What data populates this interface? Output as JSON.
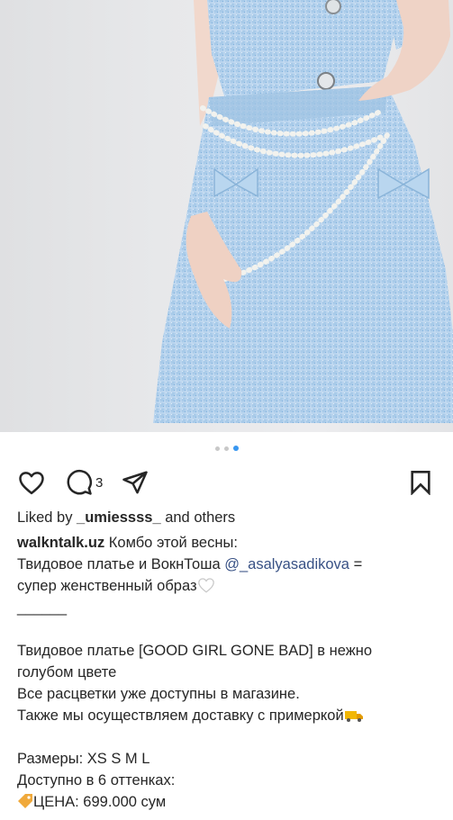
{
  "post": {
    "image_description_icon": "photo",
    "carousel": {
      "count": 3,
      "active_index": 2
    },
    "actions": {
      "like_icon": "heart-icon",
      "comment_icon": "comment-icon",
      "comment_count": "3",
      "share_icon": "send-icon",
      "save_icon": "bookmark-icon"
    },
    "likes": {
      "prefix": "Liked by ",
      "user": "_umiessss_",
      "suffix": " and others"
    },
    "caption": {
      "username": "walkntalk.uz",
      "line1": " Комбо этой весны:",
      "line2_before": "Твидовое платье и ВокнТоша ",
      "mention": "@_asalyasadikova",
      "line2_after": " =",
      "line3": "супер женственный образ",
      "line3_emoji": "white-heart",
      "divider": "______",
      "line4": "Твидовое платье [GOOD GIRL GONE BAD] в нежно",
      "line5": "голубом цвете",
      "line6": "Все расцветки уже доступны в магазине.",
      "line7": "Также мы осуществляем доставку с примеркой",
      "line7_emoji": "delivery-truck",
      "line8": "Размеры: XS S M L",
      "line9": "Доступно в 6 оттенках:",
      "line10": "ЦЕНА: 699.000 сум",
      "line10_emoji": "price-tag"
    }
  }
}
